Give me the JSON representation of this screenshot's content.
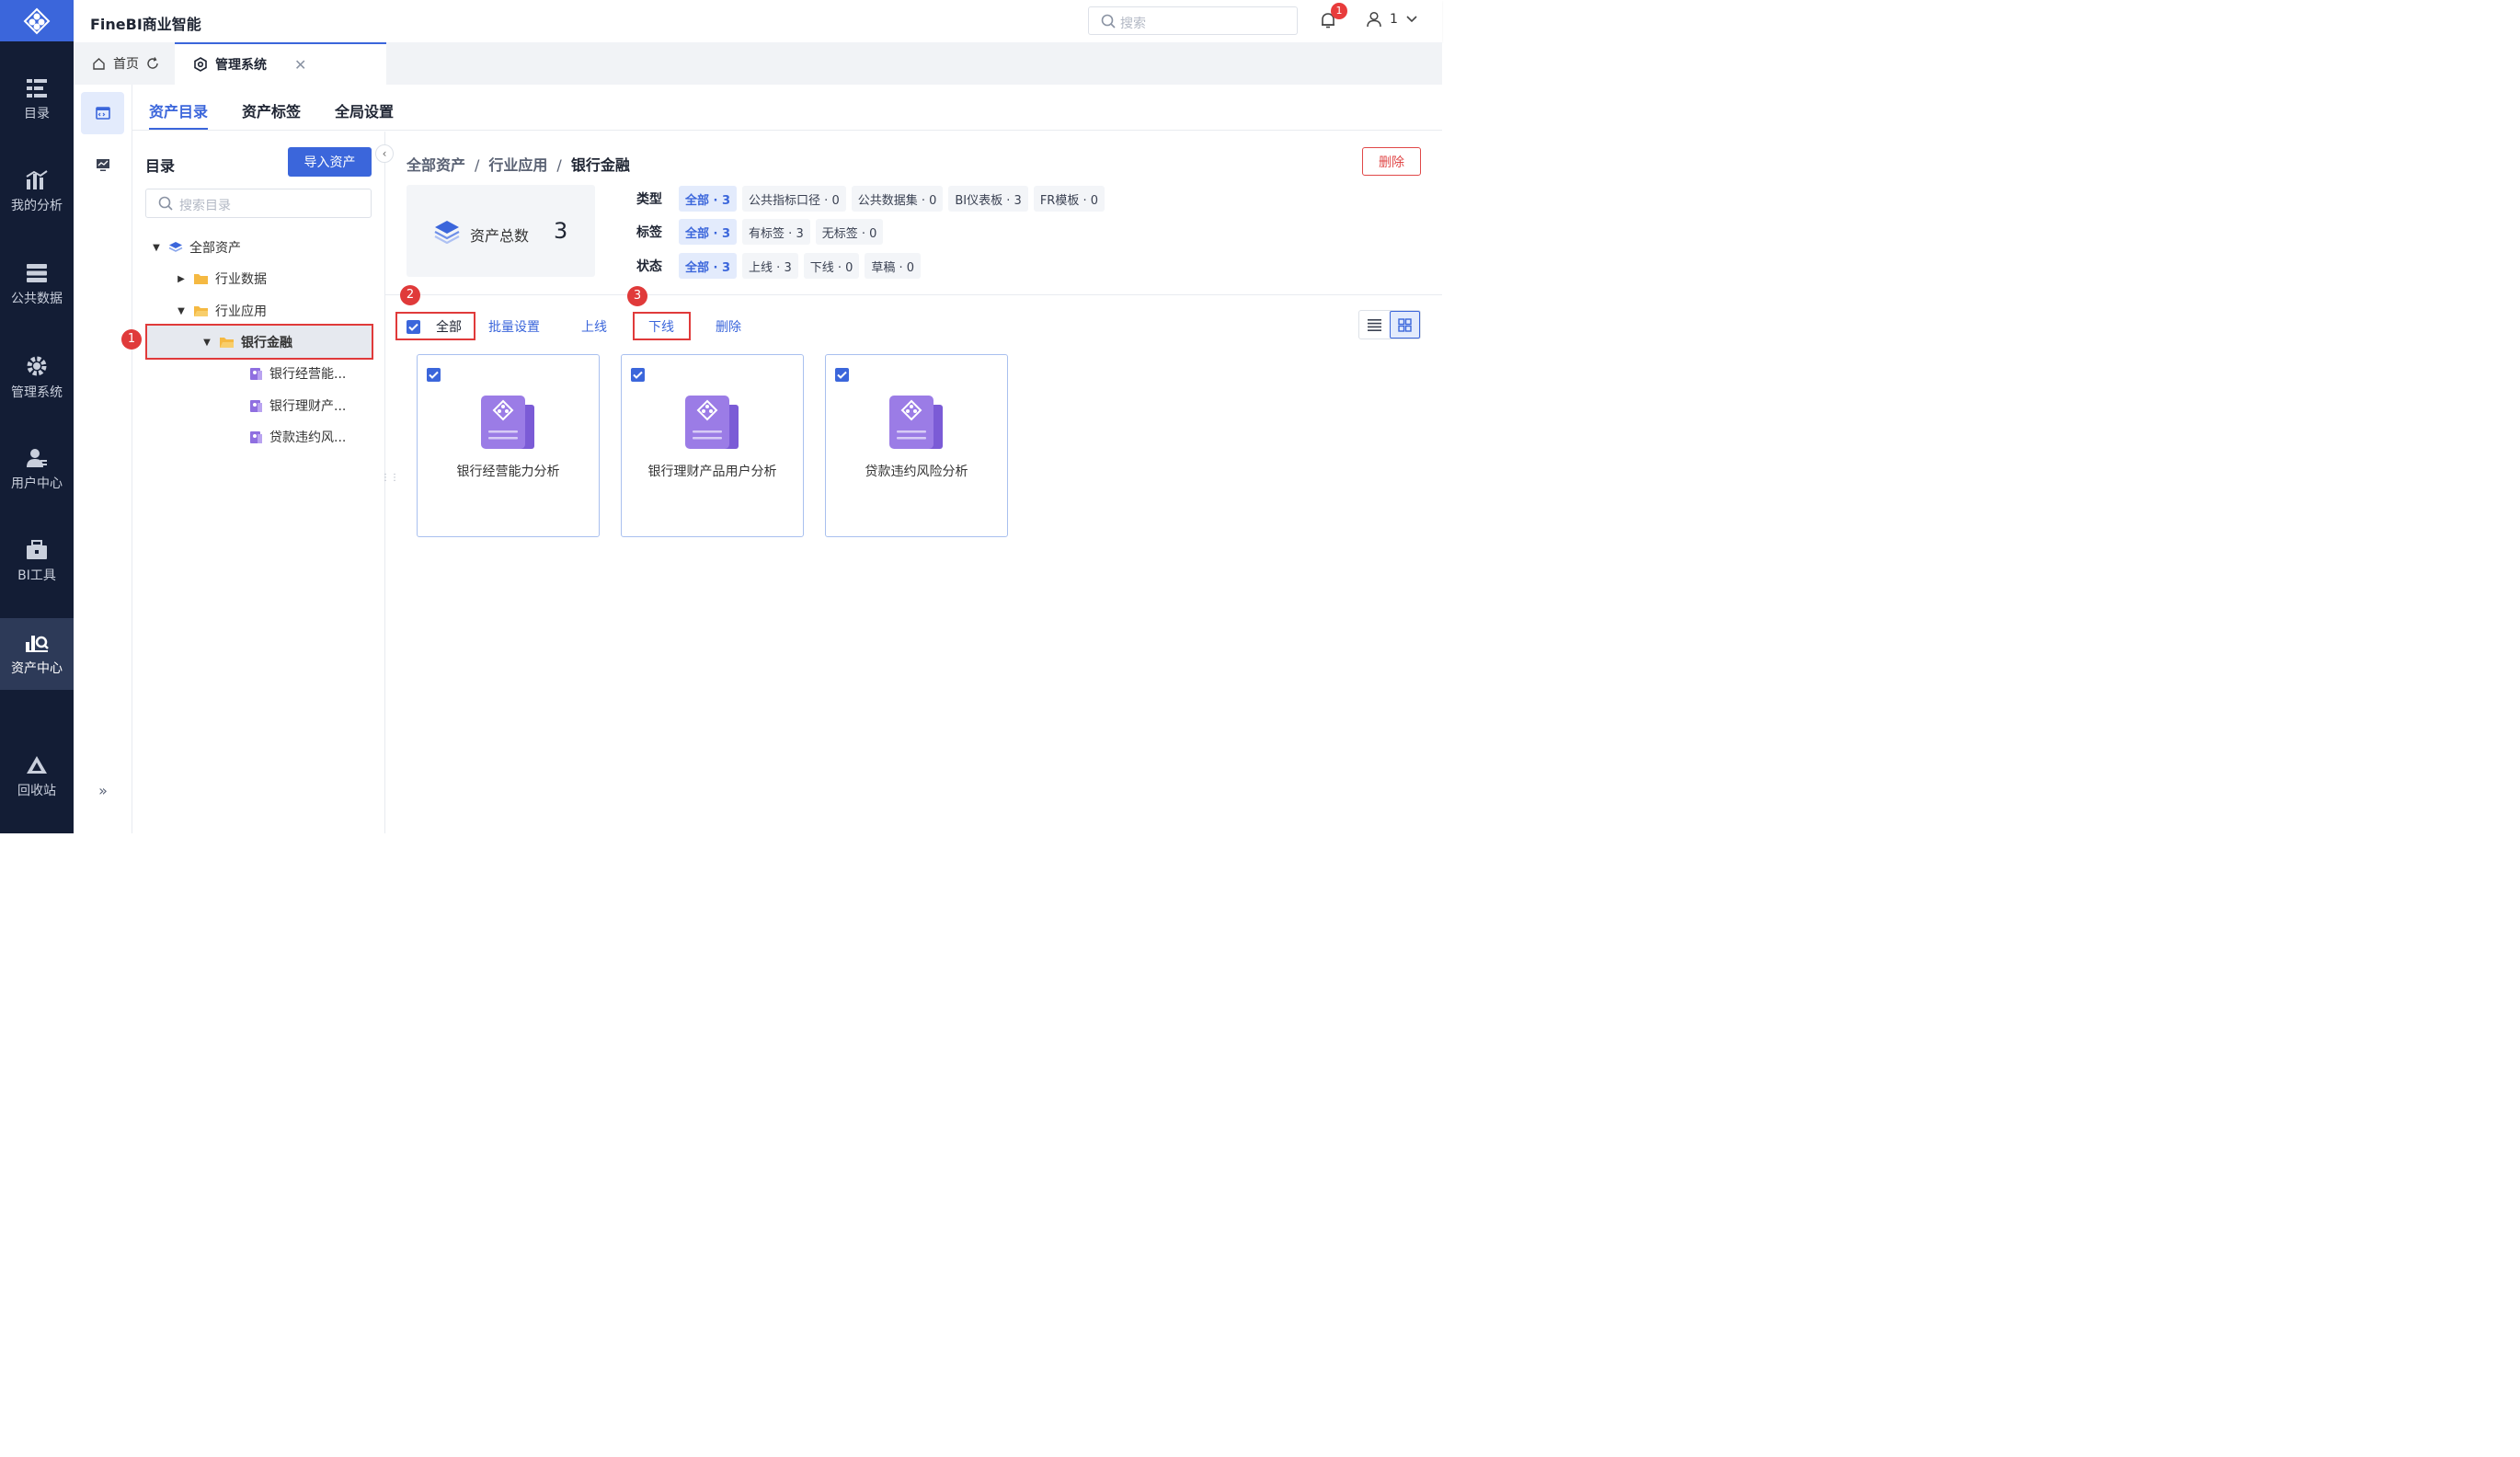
{
  "app": {
    "brand": "FineBI商业智能"
  },
  "nav": {
    "items": [
      {
        "label": "目录",
        "icon": "catalog-icon"
      },
      {
        "label": "我的分析",
        "icon": "analysis-icon"
      },
      {
        "label": "公共数据",
        "icon": "database-icon"
      },
      {
        "label": "管理系统",
        "icon": "gear-icon"
      },
      {
        "label": "用户中心",
        "icon": "user-center-icon"
      },
      {
        "label": "BI工具",
        "icon": "toolbox-icon"
      },
      {
        "label": "资产中心",
        "icon": "asset-center-icon"
      },
      {
        "label": "回收站",
        "icon": "recycle-icon"
      }
    ],
    "active": "资产中心"
  },
  "header": {
    "search_placeholder": "搜索",
    "notification_count": "1",
    "user_name": "1"
  },
  "tabs": {
    "home": "首页",
    "admin": "管理系统"
  },
  "main_tabs": [
    "资产目录",
    "资产标签",
    "全局设置"
  ],
  "tree": {
    "title": "目录",
    "import_label": "导入资产",
    "search_placeholder": "搜索目录",
    "nodes": [
      {
        "label": "全部资产"
      },
      {
        "label": "行业数据"
      },
      {
        "label": "行业应用"
      },
      {
        "label": "银行金融"
      },
      {
        "label": "银行经营能..."
      },
      {
        "label": "银行理财产..."
      },
      {
        "label": "贷款违约风..."
      }
    ]
  },
  "breadcrumb": {
    "items": [
      "全部资产",
      "行业应用",
      "银行金融"
    ]
  },
  "delete_label": "删除",
  "summary": {
    "label": "资产总数",
    "count": "3"
  },
  "filters": {
    "type": {
      "label": "类型",
      "chips": [
        "全部 · 3",
        "公共指标口径 · 0",
        "公共数据集 · 0",
        "BI仪表板 · 3",
        "FR模板 · 0"
      ]
    },
    "tag": {
      "label": "标签",
      "chips": [
        "全部 · 3",
        "有标签 · 3",
        "无标签 · 0"
      ]
    },
    "status": {
      "label": "状态",
      "chips": [
        "全部 · 3",
        "上线 · 3",
        "下线 · 0",
        "草稿 · 0"
      ]
    }
  },
  "toolbar": {
    "select_all": "全部",
    "batch": "批量设置",
    "online": "上线",
    "offline": "下线",
    "delete": "删除"
  },
  "cards": [
    {
      "name": "银行经营能力分析"
    },
    {
      "name": "银行理财产品用户分析"
    },
    {
      "name": "贷款违约风险分析"
    }
  ],
  "annotations": [
    "1",
    "2",
    "3"
  ],
  "colors": {
    "accent": "#3b66db",
    "nav_bg": "#131d35",
    "annotation": "#e03a3a",
    "folder": "#f5b942",
    "asset": "#8f6fe0"
  }
}
